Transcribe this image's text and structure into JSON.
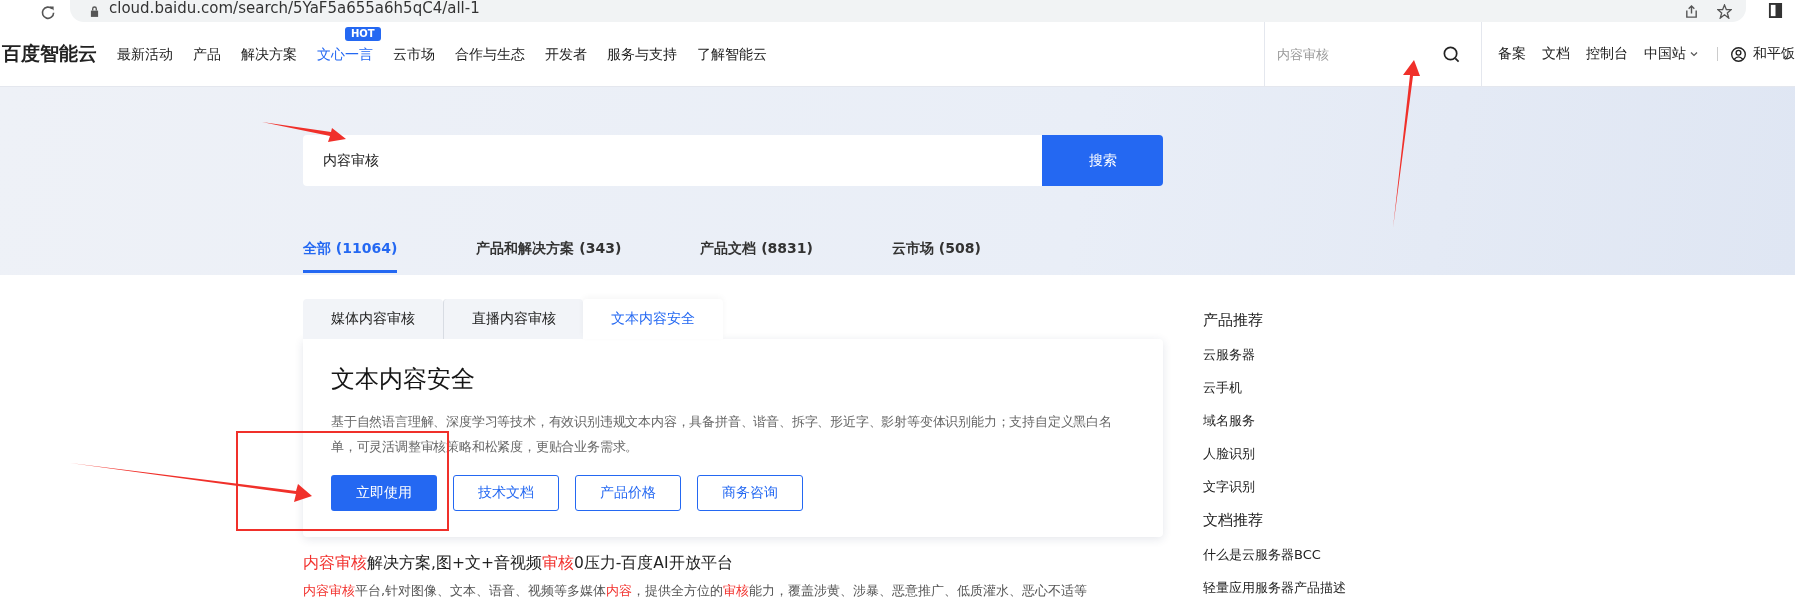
{
  "browser": {
    "url": "cloud.baidu.com/search/5YaF5a655a6h5qC4/all-1"
  },
  "header": {
    "logo": "百度智能云",
    "nav": [
      {
        "label": "最新活动",
        "selected": false
      },
      {
        "label": "产品",
        "selected": false
      },
      {
        "label": "解决方案",
        "selected": false
      },
      {
        "label": "文心一言",
        "selected": true,
        "badge": "HOT"
      },
      {
        "label": "云市场",
        "selected": false
      },
      {
        "label": "合作与生态",
        "selected": false
      },
      {
        "label": "开发者",
        "selected": false
      },
      {
        "label": "服务与支持",
        "selected": false
      },
      {
        "label": "了解智能云",
        "selected": false
      }
    ],
    "search": {
      "placeholder": "内容审核"
    },
    "links": [
      "备案",
      "文档",
      "控制台"
    ],
    "region": "中国站",
    "user": "和平饭"
  },
  "search": {
    "value": "内容审核",
    "button": "搜索"
  },
  "result_tabs": [
    {
      "label": "全部 (11064)",
      "selected": true
    },
    {
      "label": "产品和解决方案 (343)",
      "selected": false
    },
    {
      "label": "产品文档 (8831)",
      "selected": false
    },
    {
      "label": "云市场 (508)",
      "selected": false
    }
  ],
  "product_tabs": [
    {
      "label": "媒体内容审核",
      "selected": false
    },
    {
      "label": "直播内容审核",
      "selected": false
    },
    {
      "label": "文本内容安全",
      "selected": true
    }
  ],
  "product_card": {
    "title": "文本内容安全",
    "description": "基于自然语言理解、深度学习等技术，有效识别违规文本内容，具备拼音、谐音、拆字、形近字、影射等变体识别能力；支持自定义黑白名单，可灵活调整审核策略和松紧度，更贴合业务需求。",
    "buttons": [
      {
        "label": "立即使用",
        "kind": "primary"
      },
      {
        "label": "技术文档",
        "kind": "outline"
      },
      {
        "label": "产品价格",
        "kind": "outline"
      },
      {
        "label": "商务咨询",
        "kind": "outline"
      }
    ]
  },
  "results": [
    {
      "title": [
        {
          "text": "内容审核",
          "highlight": true
        },
        {
          "text": "解决方案,图+文+音视频",
          "highlight": false
        },
        {
          "text": "审核",
          "highlight": true
        },
        {
          "text": "0压力-百度AI开放平台",
          "highlight": false
        }
      ],
      "snippet": [
        {
          "text": "内容审核",
          "highlight": true
        },
        {
          "text": "平台,针对图像、文本、语音、视频等多媒体",
          "highlight": false
        },
        {
          "text": "内容",
          "highlight": true
        },
        {
          "text": "，提供全方位的",
          "highlight": false
        },
        {
          "text": "审核",
          "highlight": true
        },
        {
          "text": "能力，覆盖涉黄、涉暴、恶意推广、低质灌水、恶心不适等",
          "highlight": false
        }
      ]
    }
  ],
  "sidebar": [
    {
      "heading": "产品推荐",
      "items": [
        "云服务器",
        "云手机",
        "域名服务",
        "人脸识别",
        "文字识别"
      ]
    },
    {
      "heading": "文档推荐",
      "items": [
        "什么是云服务器BCC",
        "轻量应用服务器产品描述"
      ]
    }
  ]
}
